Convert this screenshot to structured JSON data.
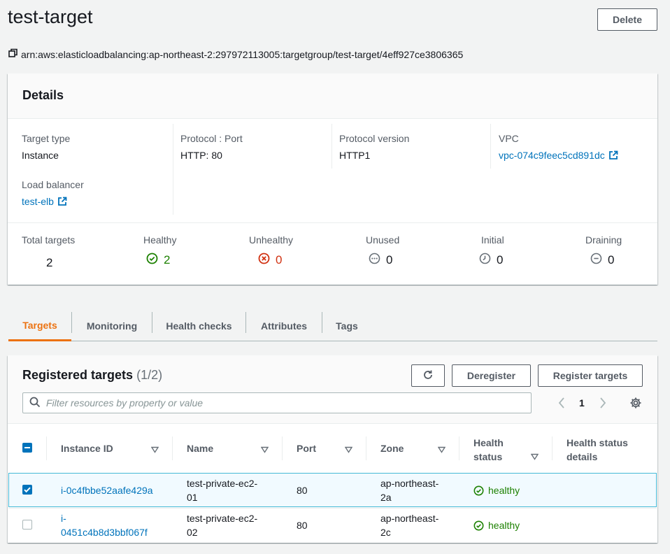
{
  "header": {
    "title": "test-target",
    "delete_label": "Delete",
    "arn": "arn:aws:elasticloadbalancing:ap-northeast-2:297972113005:targetgroup/test-target/4eff927ce3806365"
  },
  "details": {
    "heading": "Details",
    "target_type_label": "Target type",
    "target_type_value": "Instance",
    "protocol_port_label": "Protocol : Port",
    "protocol_port_value": "HTTP: 80",
    "protocol_version_label": "Protocol version",
    "protocol_version_value": "HTTP1",
    "vpc_label": "VPC",
    "vpc_value": "vpc-074c9feec5cd891dc",
    "load_balancer_label": "Load balancer",
    "load_balancer_value": "test-elb",
    "counts": {
      "total_label": "Total targets",
      "total_value": "2",
      "healthy_label": "Healthy",
      "healthy_value": "2",
      "unhealthy_label": "Unhealthy",
      "unhealthy_value": "0",
      "unused_label": "Unused",
      "unused_value": "0",
      "initial_label": "Initial",
      "initial_value": "0",
      "draining_label": "Draining",
      "draining_value": "0"
    }
  },
  "tabs": [
    "Targets",
    "Monitoring",
    "Health checks",
    "Attributes",
    "Tags"
  ],
  "registered": {
    "heading": "Registered targets",
    "count": "(1/2)",
    "deregister_label": "Deregister",
    "register_label": "Register targets",
    "search_placeholder": "Filter resources by property or value",
    "page": "1",
    "columns": {
      "instance_id": "Instance ID",
      "name": "Name",
      "port": "Port",
      "zone": "Zone",
      "health_status_1": "Health",
      "health_status_2": "status",
      "health_details_1": "Health status",
      "health_details_2": "details"
    },
    "rows": [
      {
        "instance_id": "i-0c4fbbe52aafe429a",
        "name_1": "test-private-ec2-",
        "name_2": "01",
        "port": "80",
        "zone_1": "ap-northeast-",
        "zone_2": "2a",
        "health": "healthy",
        "selected": true
      },
      {
        "instance_id_1": "i-",
        "instance_id_2": "0451c4b8d3bbf067f",
        "name_1": "test-private-ec2-",
        "name_2": "02",
        "port": "80",
        "zone_1": "ap-northeast-",
        "zone_2": "2c",
        "health": "healthy",
        "selected": false
      }
    ]
  },
  "colors": {
    "link": "#0073bb",
    "accent": "#ec7211",
    "healthy": "#1d8102",
    "unhealthy": "#d13212",
    "neutral": "#687078"
  },
  "icons": [
    "copy-icon",
    "external-link-icon",
    "check-circle-icon",
    "x-circle-icon",
    "dots-circle-icon",
    "clock-icon",
    "minus-circle-icon",
    "refresh-icon",
    "search-icon",
    "chevron-left-icon",
    "chevron-right-icon",
    "gear-icon",
    "caret-down-icon"
  ]
}
